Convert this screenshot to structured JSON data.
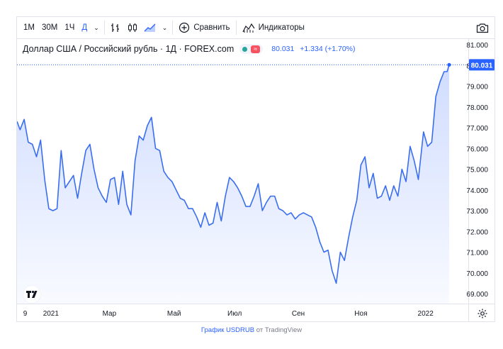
{
  "toolbar": {
    "intervals": [
      "1М",
      "30М",
      "1Ч",
      "Д"
    ],
    "active_interval": "Д",
    "compare_label": "Сравнить",
    "indicators_label": "Индикаторы"
  },
  "legend": {
    "title": "Доллар США / Российский рубль · 1Д · FOREX.com",
    "pill_symbol": "≈",
    "price": "80.031",
    "change": "+1.334 (+1.70%)"
  },
  "price_axis": {
    "labels": [
      "81.000",
      "80.000",
      "79.000",
      "78.000",
      "77.000",
      "76.000",
      "75.000",
      "74.000",
      "73.000",
      "72.000",
      "71.000",
      "70.000",
      "69.000"
    ],
    "last_price_label": "80.031"
  },
  "time_axis": {
    "labels": [
      "9",
      "2021",
      "Мар",
      "Май",
      "Июл",
      "Сен",
      "Ноя",
      "2022"
    ]
  },
  "attribution": {
    "link_text": "График USDRUB",
    "suffix": " от TradingView"
  },
  "colors": {
    "accent": "#2962ff",
    "line": "#3a6ef0",
    "last_price": "#2962ff"
  },
  "chart_data": {
    "type": "area",
    "title": "",
    "xlabel": "",
    "ylabel": "",
    "ylim": [
      68.6,
      81.3
    ],
    "x": [
      "2020-12-01",
      "2020-12-04",
      "2020-12-08",
      "2020-12-12",
      "2020-12-16",
      "2020-12-20",
      "2020-12-24",
      "2020-12-28",
      "2021-01-01",
      "2021-01-05",
      "2021-01-09",
      "2021-01-13",
      "2021-01-17",
      "2021-01-21",
      "2021-01-25",
      "2021-01-29",
      "2021-02-02",
      "2021-02-06",
      "2021-02-10",
      "2021-02-14",
      "2021-02-18",
      "2021-02-22",
      "2021-02-26",
      "2021-03-02",
      "2021-03-06",
      "2021-03-10",
      "2021-03-14",
      "2021-03-18",
      "2021-03-22",
      "2021-03-26",
      "2021-03-30",
      "2021-04-03",
      "2021-04-07",
      "2021-04-11",
      "2021-04-15",
      "2021-04-19",
      "2021-04-23",
      "2021-04-27",
      "2021-05-01",
      "2021-05-05",
      "2021-05-09",
      "2021-05-13",
      "2021-05-17",
      "2021-05-21",
      "2021-05-25",
      "2021-05-29",
      "2021-06-02",
      "2021-06-06",
      "2021-06-10",
      "2021-06-14",
      "2021-06-18",
      "2021-06-22",
      "2021-06-26",
      "2021-06-30",
      "2021-07-04",
      "2021-07-08",
      "2021-07-12",
      "2021-07-16",
      "2021-07-20",
      "2021-07-24",
      "2021-07-28",
      "2021-08-01",
      "2021-08-05",
      "2021-08-09",
      "2021-08-13",
      "2021-08-17",
      "2021-08-21",
      "2021-08-25",
      "2021-08-29",
      "2021-09-02",
      "2021-09-06",
      "2021-09-10",
      "2021-09-14",
      "2021-09-18",
      "2021-09-22",
      "2021-09-26",
      "2021-09-30",
      "2021-10-04",
      "2021-10-08",
      "2021-10-12",
      "2021-10-16",
      "2021-10-20",
      "2021-10-24",
      "2021-10-28",
      "2021-11-01",
      "2021-11-05",
      "2021-11-09",
      "2021-11-13",
      "2021-11-17",
      "2021-11-21",
      "2021-11-25",
      "2021-11-29",
      "2021-12-03",
      "2021-12-07",
      "2021-12-11",
      "2021-12-15",
      "2021-12-19",
      "2021-12-23",
      "2021-12-27",
      "2022-01-01",
      "2022-01-05",
      "2022-01-09",
      "2022-01-13",
      "2022-01-17",
      "2022-01-21",
      "2022-01-24",
      "2022-01-26"
    ],
    "series": [
      {
        "values": [
          77.3,
          76.9,
          77.4,
          76.3,
          76.2,
          75.6,
          76.4,
          74.5,
          73.1,
          73.0,
          73.1,
          75.9,
          74.1,
          74.4,
          74.7,
          73.6,
          74.8,
          75.9,
          76.2,
          75.0,
          74.1,
          73.7,
          73.4,
          74.5,
          74.6,
          73.3,
          74.9,
          73.3,
          72.8,
          75.4,
          76.6,
          76.4,
          77.1,
          77.5,
          76.0,
          75.9,
          74.9,
          74.6,
          74.4,
          74.0,
          73.6,
          73.5,
          73.1,
          73.1,
          72.7,
          72.2,
          72.9,
          72.3,
          72.4,
          73.4,
          72.5,
          73.7,
          74.6,
          74.4,
          74.1,
          73.7,
          73.2,
          73.2,
          73.7,
          74.3,
          73.0,
          73.4,
          73.7,
          73.7,
          73.1,
          73.0,
          72.8,
          72.9,
          72.6,
          72.8,
          72.9,
          72.8,
          72.7,
          72.2,
          71.5,
          71.0,
          71.1,
          70.1,
          69.5,
          71.0,
          70.6,
          71.7,
          72.7,
          73.5,
          75.2,
          75.6,
          74.1,
          74.8,
          73.6,
          73.7,
          74.2,
          73.5,
          74.2,
          73.7,
          75.0,
          74.4,
          76.1,
          75.4,
          74.5,
          76.8,
          76.1,
          76.3,
          78.5,
          79.2,
          79.7,
          79.7,
          80.031
        ]
      }
    ]
  }
}
